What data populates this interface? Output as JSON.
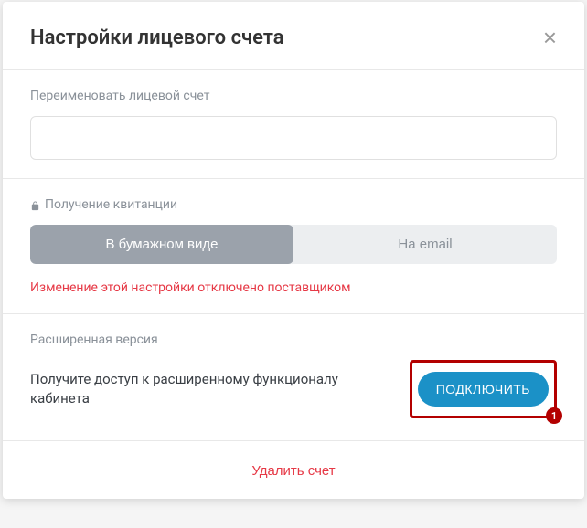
{
  "modal": {
    "title": "Настройки лицевого счета"
  },
  "rename": {
    "label": "Переименовать лицевой счет",
    "value": ""
  },
  "receipt": {
    "label": "Получение квитанции",
    "option_paper": "В бумажном виде",
    "option_email": "На email",
    "warning": "Изменение этой настройки отключено поставщиком"
  },
  "extended": {
    "label": "Расширенная версия",
    "description": "Получите доступ к расширенному функционалу кабинета",
    "connect_label": "ПОДКЛЮЧИТЬ",
    "badge": "1"
  },
  "delete": {
    "label": "Удалить счет"
  }
}
